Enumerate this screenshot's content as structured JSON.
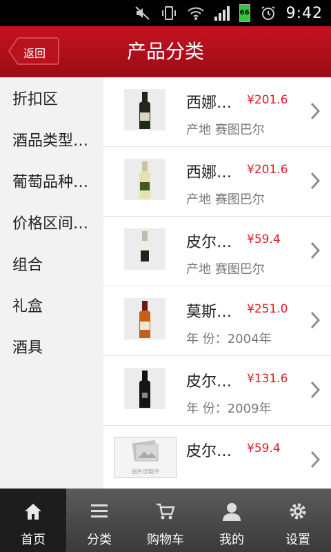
{
  "status_bar": {
    "battery_level": "66",
    "time": "9:42"
  },
  "header": {
    "back_label": "返回",
    "title": "产品分类"
  },
  "sidebar": {
    "items": [
      {
        "label": "折扣区"
      },
      {
        "label": "酒品类型…"
      },
      {
        "label": "葡萄品种…"
      },
      {
        "label": "价格区间…"
      },
      {
        "label": "组合"
      },
      {
        "label": "礼盒"
      },
      {
        "label": "酒具"
      }
    ]
  },
  "products": [
    {
      "name": "西娜…",
      "price": "¥201.6",
      "subtitle": "产地 赛图巴尔",
      "thumb": "dark-bottle"
    },
    {
      "name": "西娜…",
      "price": "¥201.6",
      "subtitle": "产地 赛图巴尔",
      "thumb": "white-bottle"
    },
    {
      "name": "皮尔…",
      "price": "¥59.4",
      "subtitle": "产地 赛图巴尔",
      "thumb": "white-bottle"
    },
    {
      "name": "莫斯…",
      "price": "¥251.0",
      "subtitle": "年 份：2004年",
      "thumb": "amber-bottle"
    },
    {
      "name": "皮尔…",
      "price": "¥131.6",
      "subtitle": "年 份：2009年",
      "thumb": "black-bottle"
    },
    {
      "name": "皮尔…",
      "price": "¥59.4",
      "subtitle": "",
      "thumb": "placeholder",
      "placeholder_label": "图片加载中"
    }
  ],
  "tabbar": {
    "items": [
      {
        "label": "首页",
        "icon": "home-icon"
      },
      {
        "label": "分类",
        "icon": "menu-icon"
      },
      {
        "label": "购物车",
        "icon": "cart-icon"
      },
      {
        "label": "我的",
        "icon": "user-icon"
      },
      {
        "label": "设置",
        "icon": "gear-icon"
      }
    ]
  },
  "colors": {
    "header_red": "#b00f1a",
    "price_red": "#e21c22",
    "tabbar_gray": "#4a4a4a"
  }
}
